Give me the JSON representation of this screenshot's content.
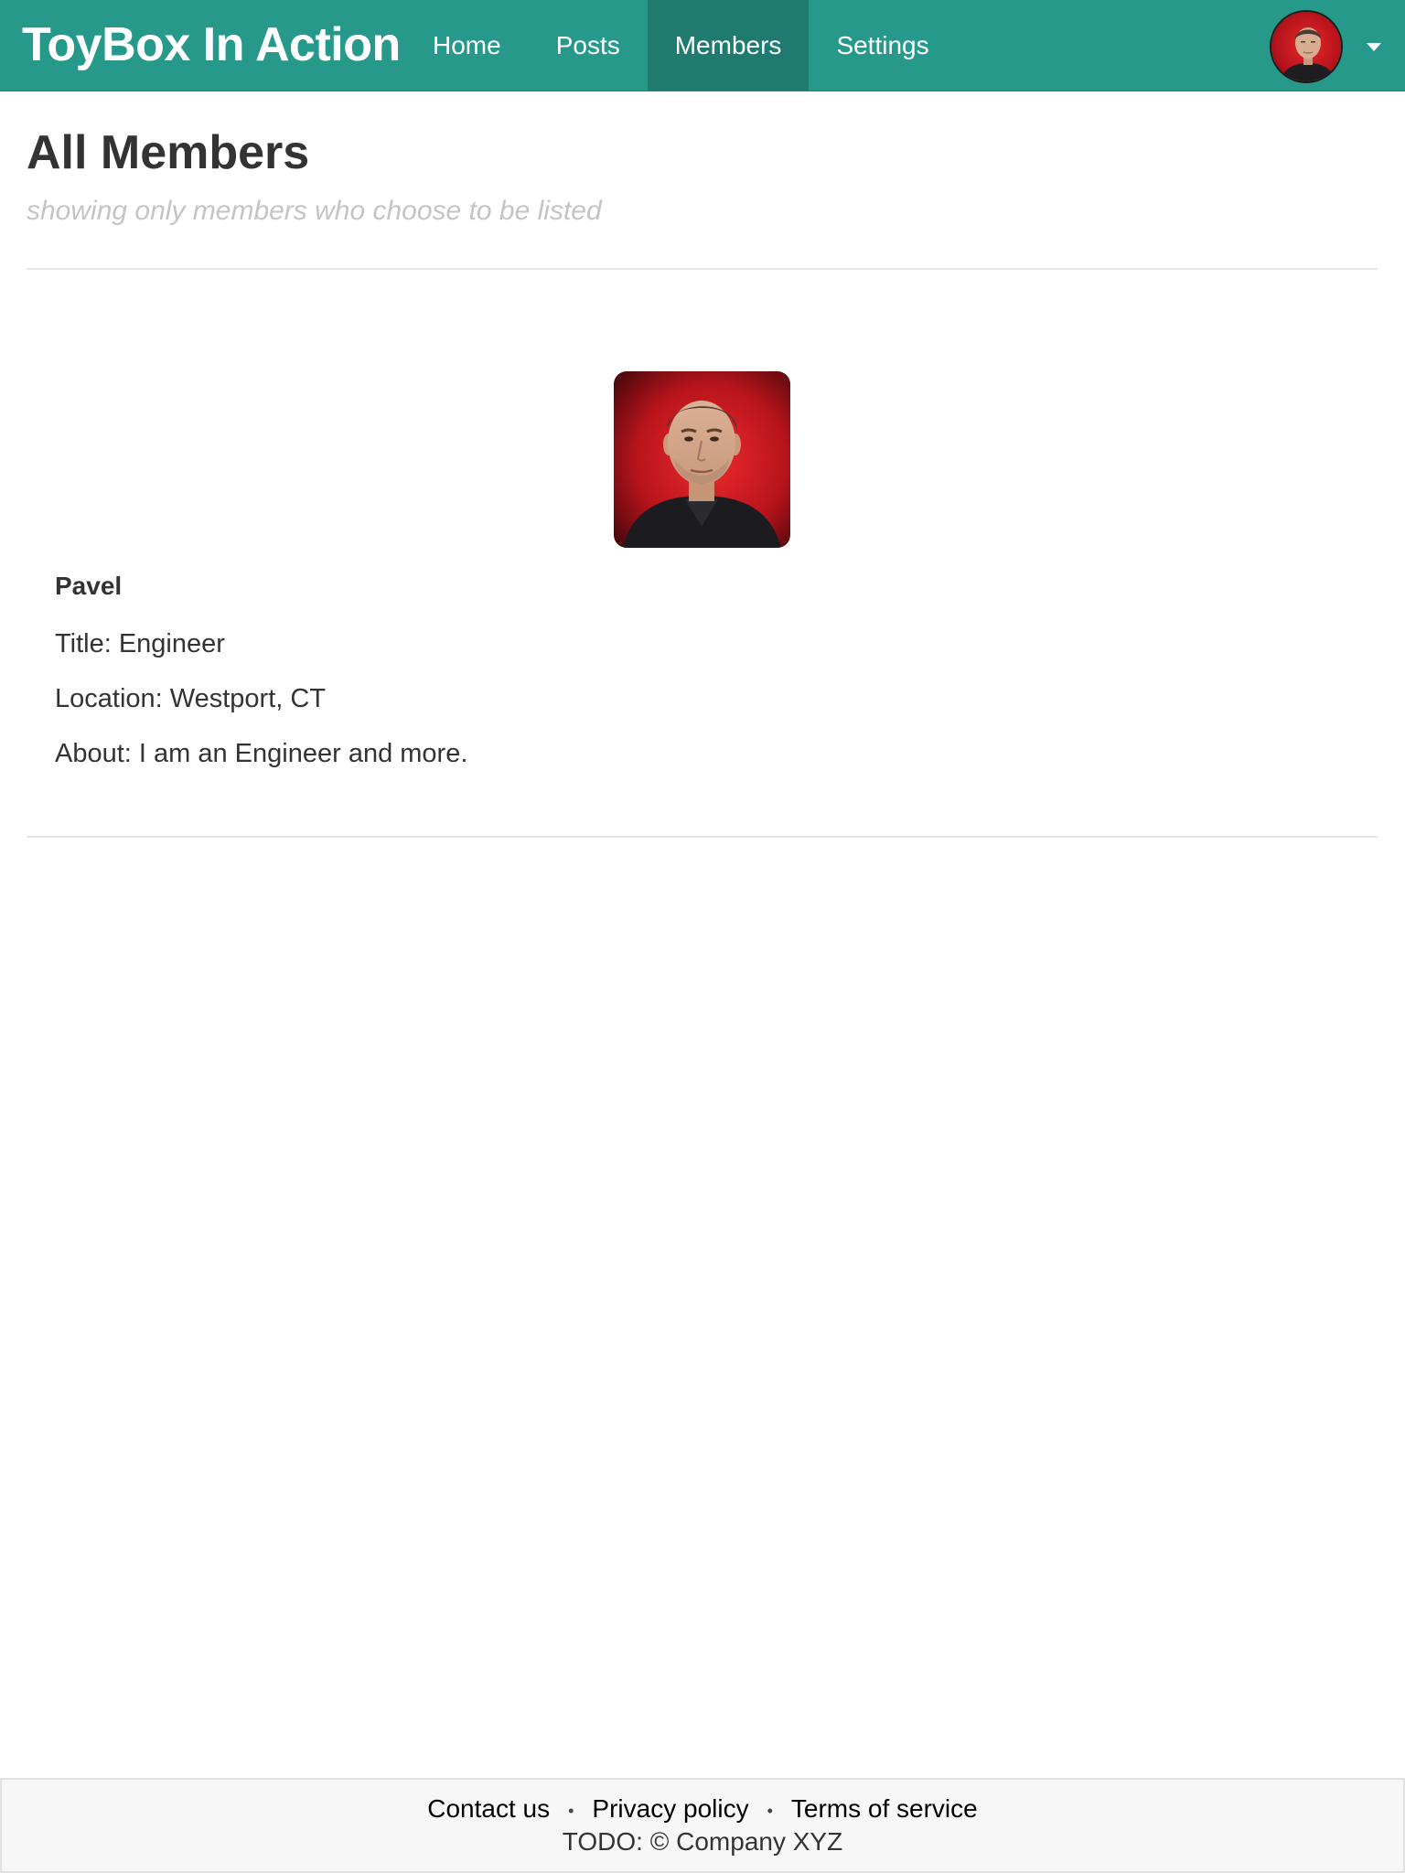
{
  "navbar": {
    "brand": "ToyBox In Action",
    "items": [
      {
        "label": "Home",
        "active": false
      },
      {
        "label": "Posts",
        "active": false
      },
      {
        "label": "Members",
        "active": true
      },
      {
        "label": "Settings",
        "active": false
      }
    ],
    "user_avatar_icon": "user-avatar-icon",
    "menu_icon": "caret-down-icon",
    "colors": {
      "background": "#26998a",
      "active_item": "#1f7b6f",
      "text": "#ffffff"
    }
  },
  "header": {
    "title": "All Members",
    "subtitle": "showing only members who choose to be listed"
  },
  "members": [
    {
      "name": "Pavel",
      "title": "Title: Engineer",
      "location": "Location: Westport, CT",
      "about": "About: I am an Engineer and more."
    }
  ],
  "footer": {
    "links": [
      {
        "label": "Contact us"
      },
      {
        "label": "Privacy policy"
      },
      {
        "label": "Terms of service"
      }
    ],
    "separator": "•",
    "copyright": "TODO: © Company XYZ"
  }
}
